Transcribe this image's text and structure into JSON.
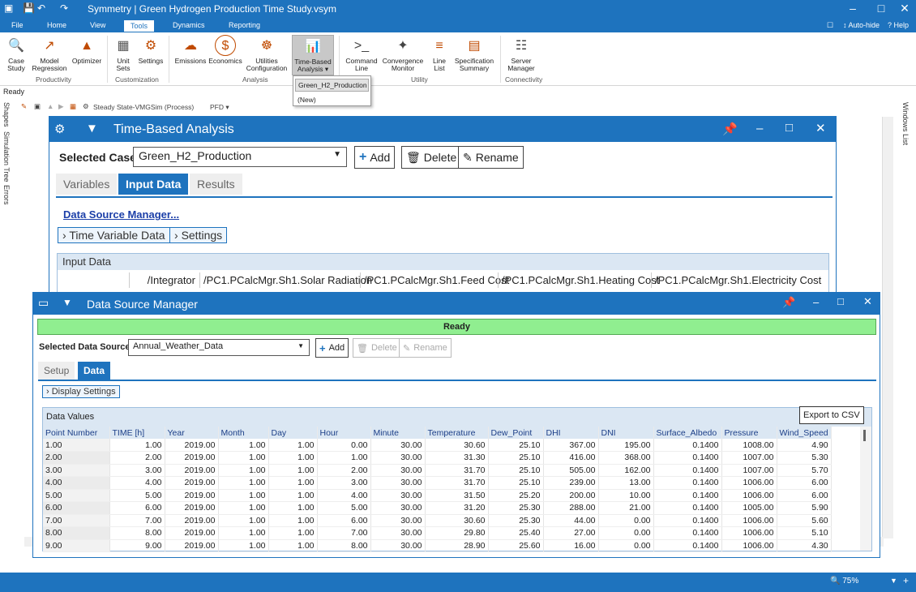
{
  "window": {
    "title": "Symmetry | Green Hydrogen Production Time Study.vsym",
    "auto_hide": "Auto-hide",
    "help": "Help"
  },
  "menu": {
    "tabs": [
      "File",
      "Home",
      "View",
      "Tools",
      "Dynamics",
      "Reporting"
    ],
    "active": "Tools"
  },
  "ribbon": {
    "buttons": {
      "case_study": "Case\nStudy",
      "model_regression": "Model\nRegression",
      "optimizer": "Optimizer",
      "unit_sets": "Unit\nSets",
      "settings": "Settings",
      "emissions": "Emissions",
      "economics": "Economics",
      "utilities_configuration": "Utilities\nConfiguration",
      "time_based_analysis": "Time-Based\nAnalysis ▾",
      "command_line": "Command\nLine",
      "convergence_monitor": "Convergence\nMonitor",
      "line_list": "Line\nList",
      "specification_summary": "Specification\nSummary",
      "server_manager": "Server\nManager"
    },
    "groups": {
      "productivity": "Productivity",
      "customization": "Customization",
      "analysis": "Analysis",
      "utility": "Utility",
      "connectivity": "Connectivity"
    },
    "dropdown": {
      "items": [
        "Green_H2_Production",
        "(New)"
      ]
    }
  },
  "status": {
    "ready": "Ready",
    "toolbar_mode": "Steady State-VMGSim (Process)",
    "toolbar_view": "PFD",
    "zoom": "75%"
  },
  "side_tabs": {
    "left": [
      "Shapes",
      "Simulation Tree",
      "Errors"
    ],
    "right": [
      "Windows List"
    ]
  },
  "time_based_analysis": {
    "title": "Time-Based Analysis",
    "selected_case_label": "Selected Case:",
    "selected_case": "Green_H2_Production",
    "add": "Add",
    "delete": "Delete",
    "rename": "Rename",
    "tabs": [
      "Variables",
      "Input Data",
      "Results"
    ],
    "active_tab": "Input Data",
    "data_source_link": "Data Source Manager...",
    "time_variable_data": "Time Variable Data",
    "settings": "Settings",
    "input_data_caption": "Input Data",
    "columns": [
      "/Integrator",
      "/PC1.PCalcMgr.Sh1.Solar Radiation",
      "/PC1.PCalcMgr.Sh1.Feed Cost",
      "/PC1.PCalcMgr.Sh1.Heating Cost",
      "/PC1.PCalcMgr.Sh1.Electricity Cost"
    ]
  },
  "data_source_manager": {
    "title": "Data Source Manager",
    "status": "Ready",
    "selected_label": "Selected Data Source:",
    "selected": "Annual_Weather_Data",
    "add": "Add",
    "delete": "Delete",
    "rename": "Rename",
    "tabs": [
      "Setup",
      "Data"
    ],
    "active_tab": "Data",
    "display_settings": "Display Settings",
    "data_values_caption": "Data Values",
    "export_csv": "Export to CSV",
    "columns": [
      "Point Number",
      "TIME [h]",
      "Year",
      "Month",
      "Day",
      "Hour",
      "Minute",
      "Temperature",
      "Dew_Point",
      "DHI",
      "DNI",
      "Surface_Albedo",
      "Pressure",
      "Wind_Speed"
    ],
    "rows": [
      [
        "1.00",
        "1.00",
        "2019.00",
        "1.00",
        "1.00",
        "0.00",
        "30.00",
        "30.60",
        "25.10",
        "367.00",
        "195.00",
        "0.1400",
        "1008.00",
        "4.90"
      ],
      [
        "2.00",
        "2.00",
        "2019.00",
        "1.00",
        "1.00",
        "1.00",
        "30.00",
        "31.30",
        "25.10",
        "416.00",
        "368.00",
        "0.1400",
        "1007.00",
        "5.30"
      ],
      [
        "3.00",
        "3.00",
        "2019.00",
        "1.00",
        "1.00",
        "2.00",
        "30.00",
        "31.70",
        "25.10",
        "505.00",
        "162.00",
        "0.1400",
        "1007.00",
        "5.70"
      ],
      [
        "4.00",
        "4.00",
        "2019.00",
        "1.00",
        "1.00",
        "3.00",
        "30.00",
        "31.70",
        "25.10",
        "239.00",
        "13.00",
        "0.1400",
        "1006.00",
        "6.00"
      ],
      [
        "5.00",
        "5.00",
        "2019.00",
        "1.00",
        "1.00",
        "4.00",
        "30.00",
        "31.50",
        "25.20",
        "200.00",
        "10.00",
        "0.1400",
        "1006.00",
        "6.00"
      ],
      [
        "6.00",
        "6.00",
        "2019.00",
        "1.00",
        "1.00",
        "5.00",
        "30.00",
        "31.20",
        "25.30",
        "288.00",
        "21.00",
        "0.1400",
        "1005.00",
        "5.90"
      ],
      [
        "7.00",
        "7.00",
        "2019.00",
        "1.00",
        "1.00",
        "6.00",
        "30.00",
        "30.60",
        "25.30",
        "44.00",
        "0.00",
        "0.1400",
        "1006.00",
        "5.60"
      ],
      [
        "8.00",
        "8.00",
        "2019.00",
        "1.00",
        "1.00",
        "7.00",
        "30.00",
        "29.80",
        "25.40",
        "27.00",
        "0.00",
        "0.1400",
        "1006.00",
        "5.10"
      ],
      [
        "9.00",
        "9.00",
        "2019.00",
        "1.00",
        "1.00",
        "8.00",
        "30.00",
        "28.90",
        "25.60",
        "16.00",
        "0.00",
        "0.1400",
        "1006.00",
        "4.30"
      ]
    ]
  },
  "colors": {
    "brand": "#1e73be",
    "ready_green": "#90ee90"
  }
}
